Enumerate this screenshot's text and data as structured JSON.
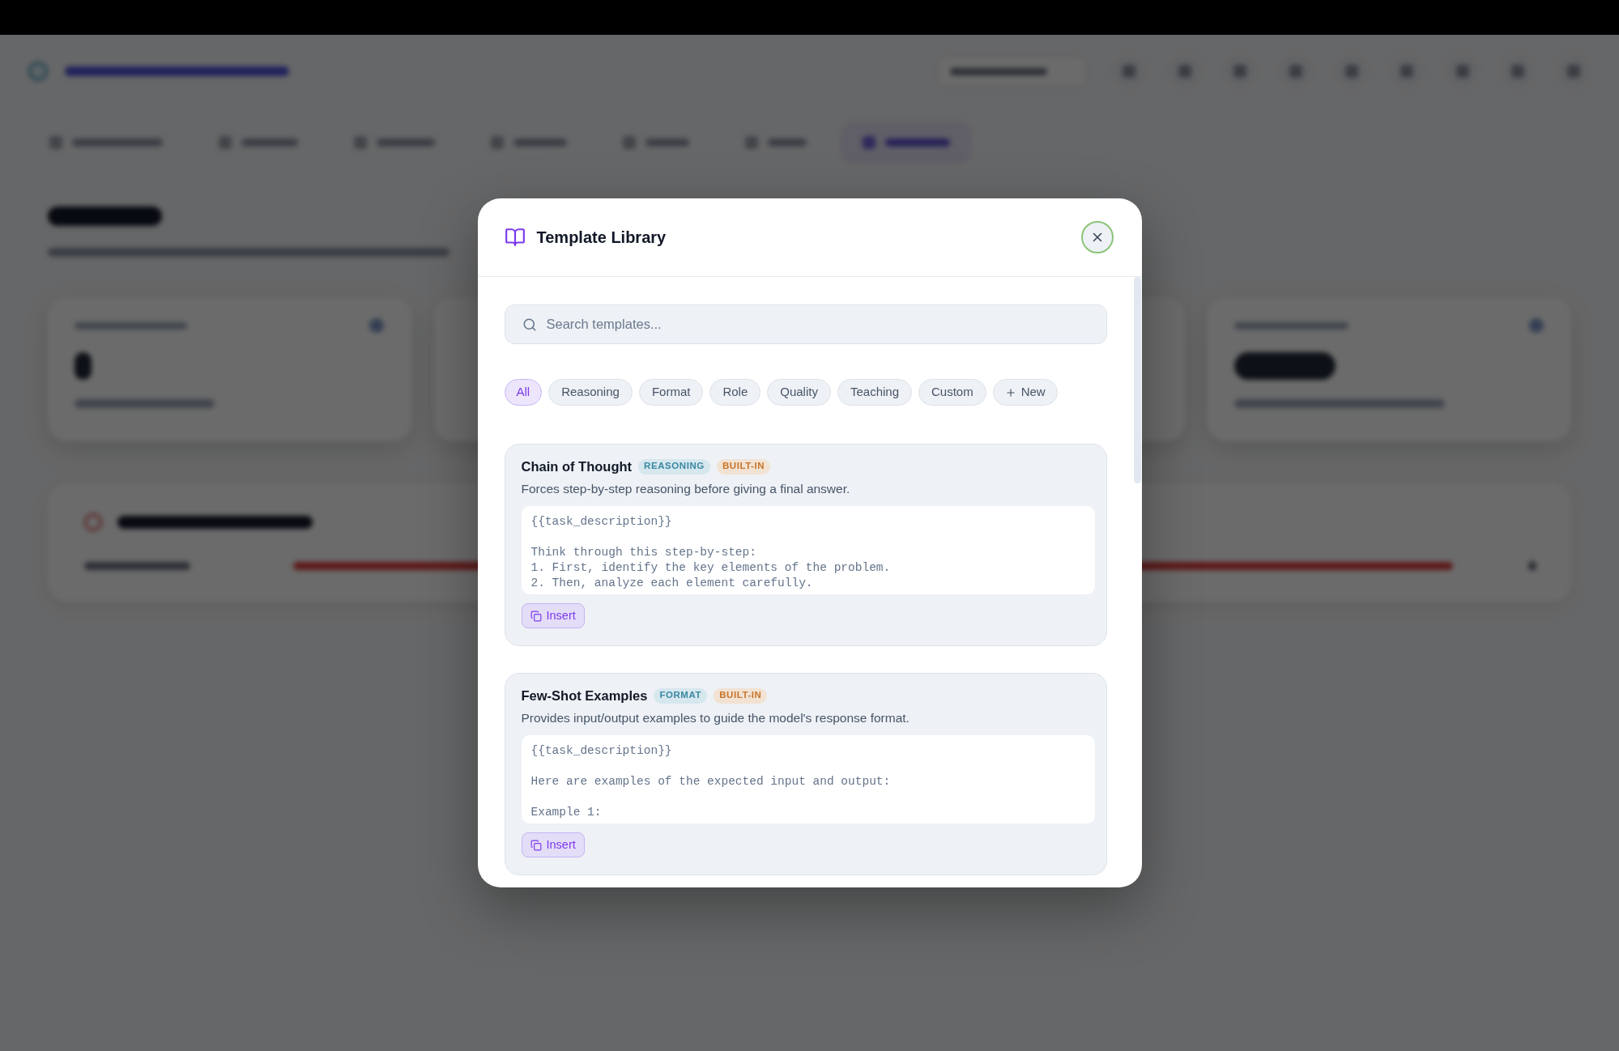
{
  "backdrop": {
    "nav_tabs": [
      {
        "selected": false
      },
      {
        "selected": false
      },
      {
        "selected": false
      },
      {
        "selected": false
      },
      {
        "selected": false
      },
      {
        "selected": false
      },
      {
        "selected": true
      }
    ],
    "failure_modes": {
      "rows": [
        {
          "level": 1
        }
      ]
    }
  },
  "dialog": {
    "title": "Template Library",
    "search": {
      "placeholder": "Search templates..."
    },
    "filters": [
      {
        "label": "All",
        "selected": true
      },
      {
        "label": "Reasoning",
        "selected": false
      },
      {
        "label": "Format",
        "selected": false
      },
      {
        "label": "Role",
        "selected": false
      },
      {
        "label": "Quality",
        "selected": false
      },
      {
        "label": "Teaching",
        "selected": false
      },
      {
        "label": "Custom",
        "selected": false
      }
    ],
    "new_button": {
      "label": "New"
    },
    "templates": [
      {
        "name": "Chain of Thought",
        "badges": [
          {
            "kind": "category",
            "label": "REASONING"
          },
          {
            "kind": "origin",
            "label": "BUILT-IN"
          }
        ],
        "description": "Forces step-by-step reasoning before giving a final answer.",
        "body": "{{task_description}}\n\nThink through this step-by-step:\n1. First, identify the key elements of the problem.\n2. Then, analyze each element carefully.",
        "action": "Insert"
      },
      {
        "name": "Few-Shot Examples",
        "badges": [
          {
            "kind": "category",
            "label": "FORMAT"
          },
          {
            "kind": "origin",
            "label": "BUILT-IN"
          }
        ],
        "description": "Provides input/output examples to guide the model's response format.",
        "body": "{{task_description}}\n\nHere are examples of the expected input and output:\n\nExample 1:",
        "action": "Insert"
      }
    ]
  }
}
